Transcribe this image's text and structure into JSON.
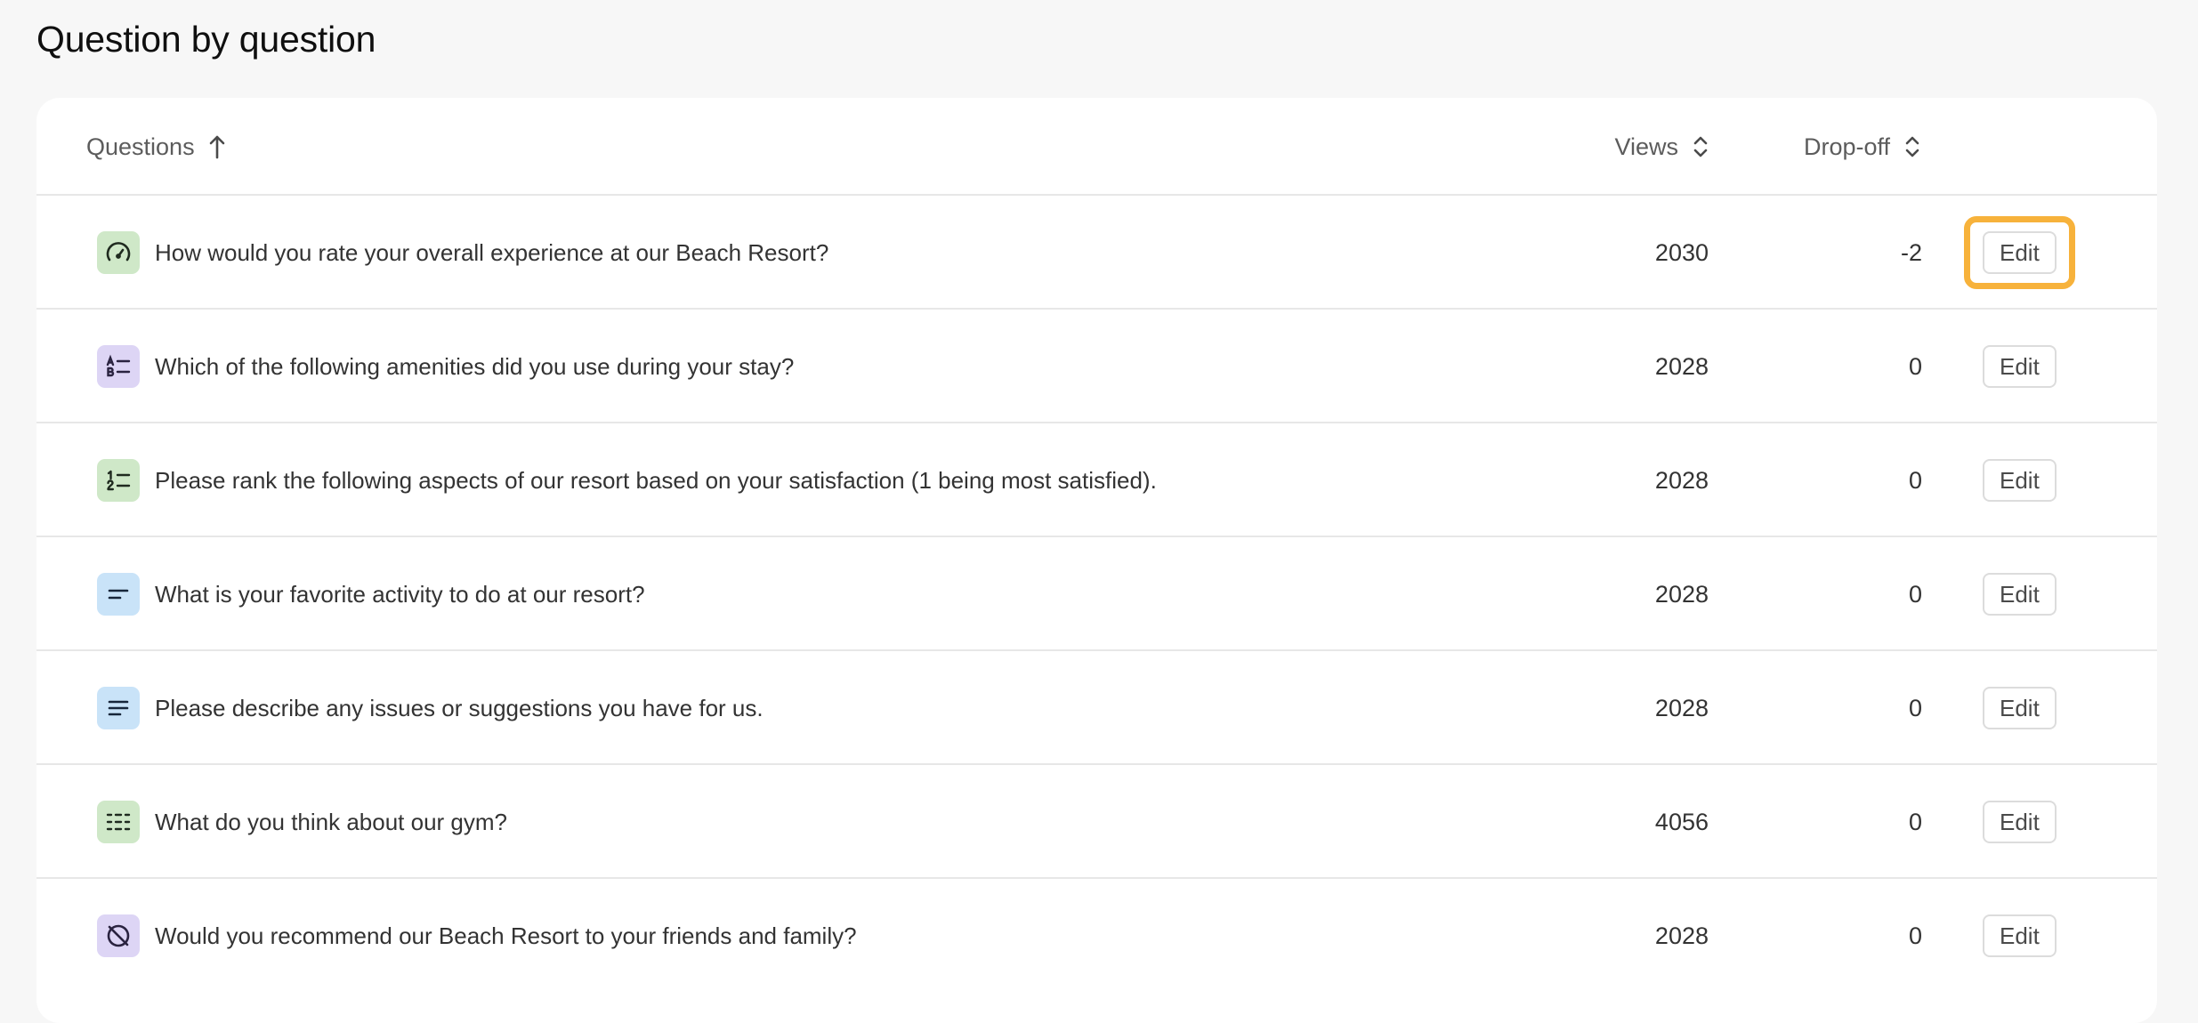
{
  "page": {
    "title": "Question by question"
  },
  "table": {
    "headers": {
      "questions": "Questions",
      "views": "Views",
      "dropoff": "Drop-off"
    },
    "highlight_color": "#f7b23b",
    "rows": [
      {
        "icon": "rating-gauge-icon",
        "icon_bg": "#cfe8c8",
        "question": "How would you rate your overall experience at our Beach Resort?",
        "views": "2030",
        "dropoff": "-2",
        "edit_label": "Edit",
        "highlighted": true
      },
      {
        "icon": "multiple-choice-icon",
        "icon_bg": "#ddd5f5",
        "question": "Which of the following amenities did you use during your stay?",
        "views": "2028",
        "dropoff": "0",
        "edit_label": "Edit"
      },
      {
        "icon": "ranking-icon",
        "icon_bg": "#cfe8c8",
        "question": "Please rank the following aspects of our resort based on your satisfaction (1 being most satisfied).",
        "views": "2028",
        "dropoff": "0",
        "edit_label": "Edit"
      },
      {
        "icon": "short-text-icon",
        "icon_bg": "#c9e3f8",
        "question": "What is your favorite activity to do at our resort?",
        "views": "2028",
        "dropoff": "0",
        "edit_label": "Edit"
      },
      {
        "icon": "long-text-icon",
        "icon_bg": "#c9e3f8",
        "question": "Please describe any issues or suggestions you have for us.",
        "views": "2028",
        "dropoff": "0",
        "edit_label": "Edit"
      },
      {
        "icon": "matrix-grid-icon",
        "icon_bg": "#cfe8c8",
        "question": "What do you think about our gym?",
        "views": "4056",
        "dropoff": "0",
        "edit_label": "Edit"
      },
      {
        "icon": "yes-no-icon",
        "icon_bg": "#ddd5f5",
        "question": "Would you recommend our Beach Resort to your friends and family?",
        "views": "2028",
        "dropoff": "0",
        "edit_label": "Edit"
      }
    ]
  }
}
